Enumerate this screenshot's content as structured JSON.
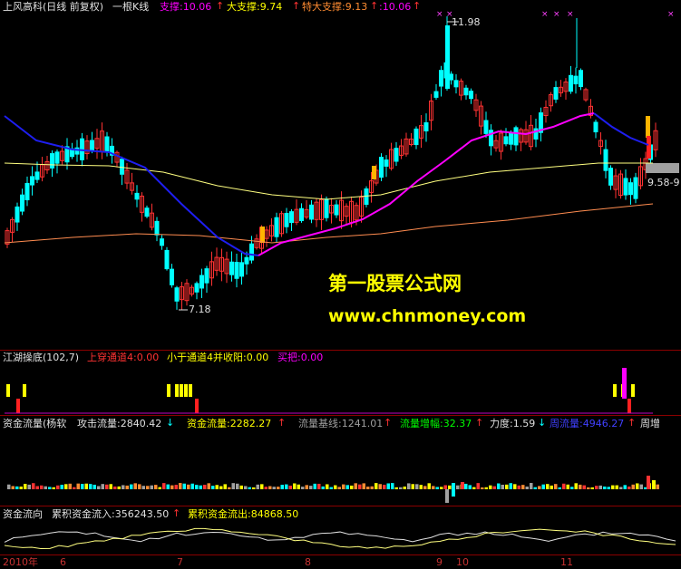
{
  "main_header": {
    "title": "上风高科(日线 前复权)",
    "indicator": "一根K线",
    "support_label": "支撑:10.06",
    "big_support_label": "大支撑:9.74",
    "extra_support_label": "特大支撑:9.13",
    "tail_value": ":10.06"
  },
  "price_annotations": {
    "high": "11.98",
    "low": "7.18",
    "right_value": "9.58-9"
  },
  "watermark": {
    "name": "第一股票公式网",
    "url": "www.chnmoney.com"
  },
  "panel2_header": {
    "title": "江湖操底(102,7)",
    "label1": "上穿通道4:0.00",
    "label2": "小于通道4并收阳:0.00",
    "label3": "买把:0.00"
  },
  "panel3_header": {
    "title": "资金流量(杨软",
    "attack": "攻击流量:2840.42",
    "funds": "资金流量:2282.27",
    "baseline": "流量基线:1241.01",
    "growth": "流量增幅:32.37",
    "strength": "力度:1.59",
    "weekly": "周流量:4946.27",
    "week_tag": "周增"
  },
  "panel4_header": {
    "title": "资金流向",
    "inflow": "累积资金流入:356243.50",
    "outflow": "累积资金流出:84868.50"
  },
  "time_axis": {
    "year_label": "2010年",
    "ticks": [
      "6",
      "7",
      "8",
      "9",
      "10",
      "11"
    ]
  },
  "colors": {
    "up": "#ff3232",
    "down": "#00ffff",
    "ma_long": "#ffff80",
    "ma_mid": "#1e1ef0",
    "ma_pink": "#ff00ff",
    "ma_brown": "#ff8c50",
    "separator": "#8b0000"
  }
}
